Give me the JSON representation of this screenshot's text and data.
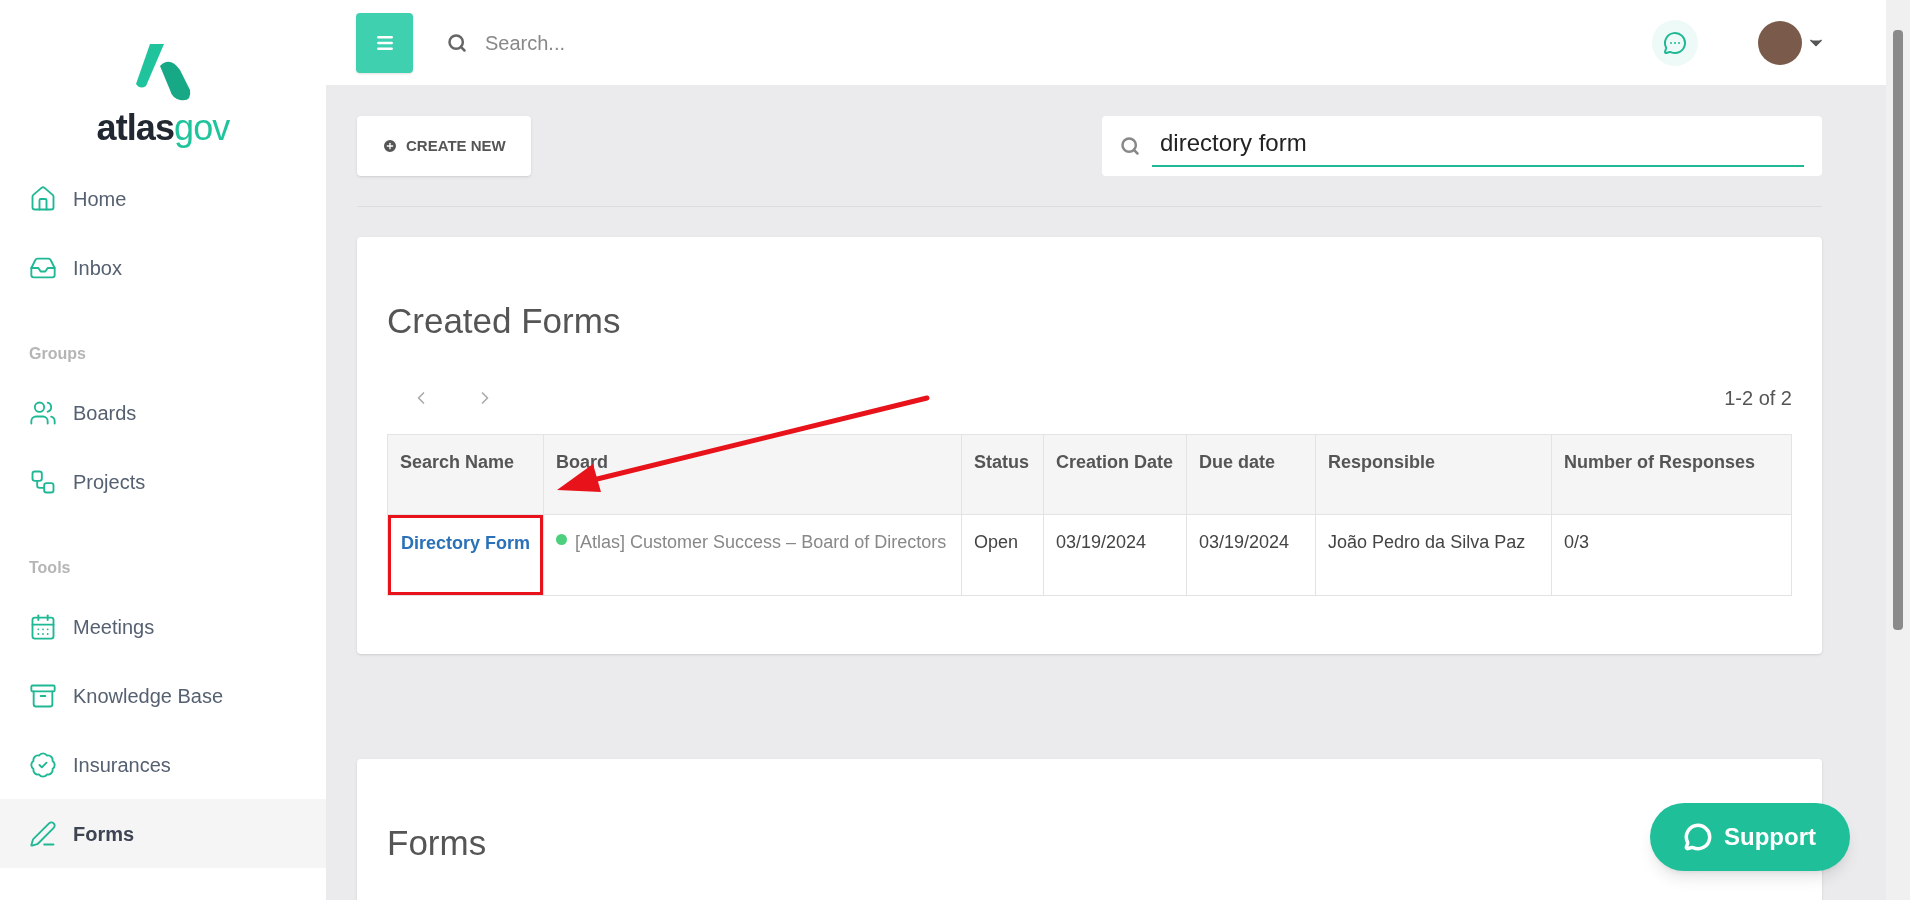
{
  "logo": {
    "wordmark_dark": "atlas",
    "wordmark_light": "gov"
  },
  "sidebar": {
    "sections": [
      {
        "items": [
          {
            "label": "Home",
            "selected": false
          },
          {
            "label": "Inbox",
            "selected": false
          }
        ]
      },
      {
        "heading": "Groups",
        "items": [
          {
            "label": "Boards",
            "selected": false
          },
          {
            "label": "Projects",
            "selected": false
          }
        ]
      },
      {
        "heading": "Tools",
        "items": [
          {
            "label": "Meetings",
            "selected": false
          },
          {
            "label": "Knowledge Base",
            "selected": false
          },
          {
            "label": "Insurances",
            "selected": false
          },
          {
            "label": "Forms",
            "selected": true
          }
        ]
      }
    ]
  },
  "topbar": {
    "search": {
      "placeholder": "Search..."
    }
  },
  "toolbar": {
    "create_button": "CREATE NEW",
    "search": {
      "value": "directory form"
    }
  },
  "created_forms": {
    "title": "Created Forms",
    "range": "1-2 of 2",
    "columns": [
      "Search Name",
      "Board",
      "Status",
      "Creation Date",
      "Due date",
      "Responsible",
      "Number of Responses"
    ],
    "rows": [
      {
        "name": "Directory Form",
        "board": "[Atlas] Customer Success – Board of Directors",
        "color": "#4cd07d",
        "status": "Open",
        "created": "03/19/2024",
        "due": "03/19/2024",
        "responsible": "João Pedro da Silva Paz",
        "responses": "0/3"
      }
    ]
  },
  "forms": {
    "title": "Forms"
  },
  "support_button": "Support"
}
